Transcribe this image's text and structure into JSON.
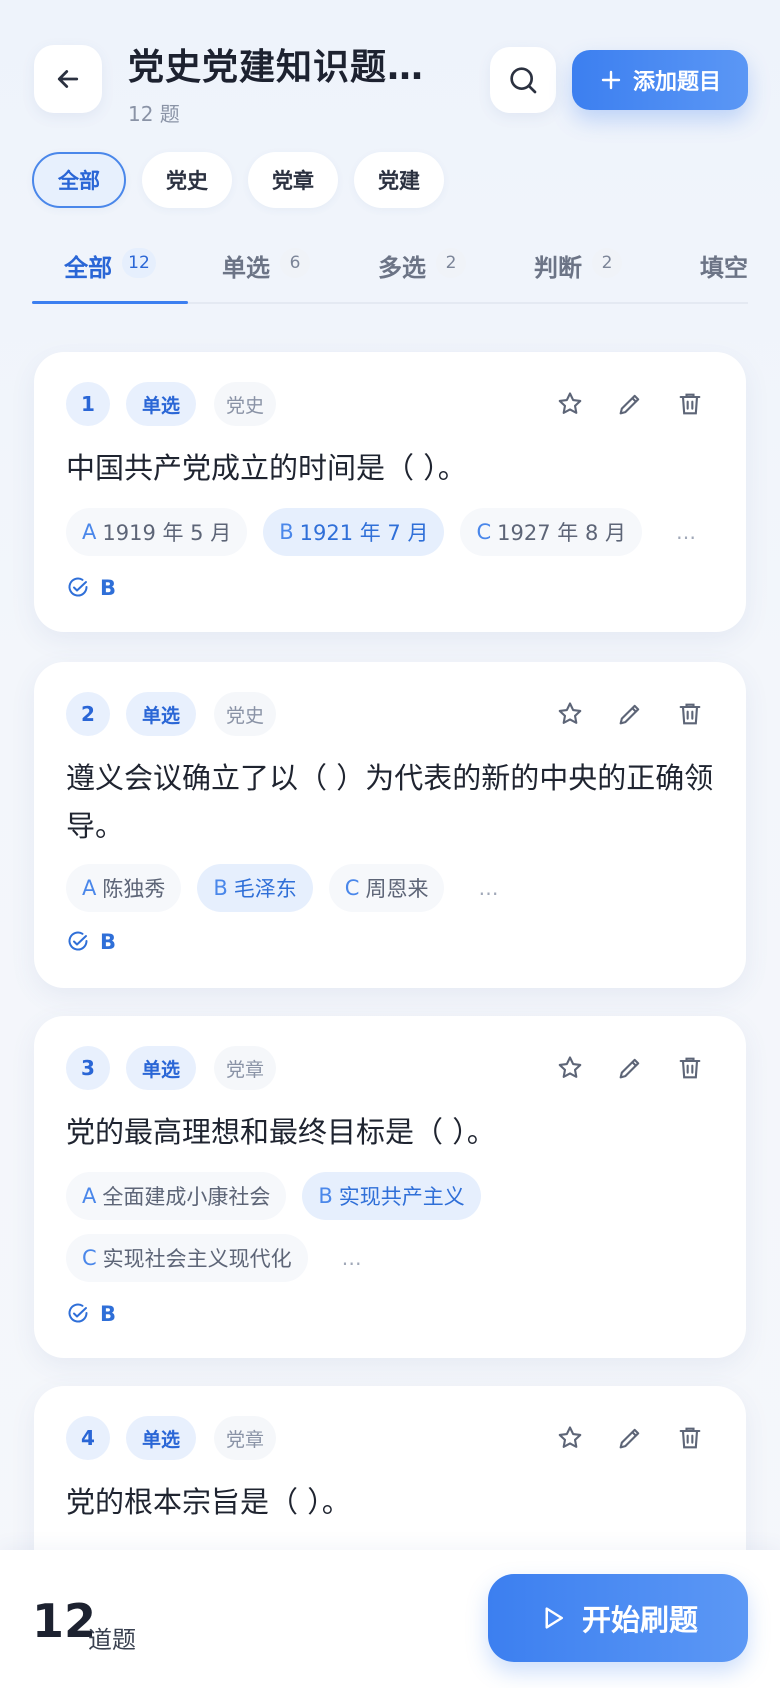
{
  "header": {
    "title": "党史党建知识题库...",
    "subtitle": "12 题",
    "add_label": "添加题目"
  },
  "categories": [
    "全部",
    "党史",
    "党章",
    "党建"
  ],
  "tabs": [
    {
      "label": "全部",
      "count": "12"
    },
    {
      "label": "单选",
      "count": "6"
    },
    {
      "label": "多选",
      "count": "2"
    },
    {
      "label": "判断",
      "count": "2"
    },
    {
      "label": "填空",
      "count": ""
    }
  ],
  "questions": [
    {
      "num": "1",
      "type": "单选",
      "category": "党史",
      "text": "中国共产党成立的时间是（ ）。",
      "options": [
        {
          "letter": "A",
          "text": "1919 年 5 月"
        },
        {
          "letter": "B",
          "text": "1921 年 7 月"
        },
        {
          "letter": "C",
          "text": "1927 年 8 月"
        }
      ],
      "more": "…",
      "answer": "B"
    },
    {
      "num": "2",
      "type": "单选",
      "category": "党史",
      "text": "遵义会议确立了以（ ）为代表的新的中央的正确领导。",
      "options": [
        {
          "letter": "A",
          "text": "陈独秀"
        },
        {
          "letter": "B",
          "text": "毛泽东"
        },
        {
          "letter": "C",
          "text": "周恩来"
        }
      ],
      "more": "…",
      "answer": "B"
    },
    {
      "num": "3",
      "type": "单选",
      "category": "党章",
      "text": "党的最高理想和最终目标是（ ）。",
      "options": [
        {
          "letter": "A",
          "text": "全面建成小康社会"
        },
        {
          "letter": "B",
          "text": "实现共产主义"
        },
        {
          "letter": "C",
          "text": "实现社会主义现代化"
        }
      ],
      "more": "…",
      "answer": "B"
    },
    {
      "num": "4",
      "type": "单选",
      "category": "党章",
      "text": "党的根本宗旨是（ ）。"
    }
  ],
  "footer": {
    "total": "12",
    "total_label": "道题",
    "start_label": "开始刷题"
  }
}
